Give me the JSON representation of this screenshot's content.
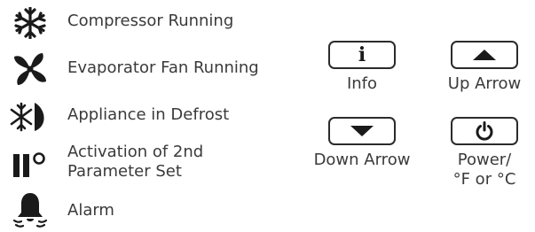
{
  "legend": [
    {
      "icon": "snowflake-icon",
      "label": "Compressor Running"
    },
    {
      "icon": "fan-icon",
      "label": "Evaporator Fan Running"
    },
    {
      "icon": "defrost-icon",
      "label": "Appliance in Defrost"
    },
    {
      "icon": "parameter-set-icon",
      "label_line1": "Activation of 2nd",
      "label_line2": "Parameter Set"
    },
    {
      "icon": "bell-icon",
      "label": "Alarm"
    }
  ],
  "keys": {
    "info": {
      "glyph": "i",
      "label": "Info",
      "icon": "info-icon"
    },
    "up": {
      "label": "Up Arrow",
      "icon": "up-arrow-icon"
    },
    "down": {
      "label": "Down Arrow",
      "icon": "down-arrow-icon"
    },
    "power": {
      "label_line1": "Power/",
      "label_line2": "°F or °C",
      "icon": "power-icon"
    }
  },
  "colors": {
    "icon": "#1a1a1a",
    "text": "#3a3a3a",
    "border": "#2b2b2b"
  }
}
